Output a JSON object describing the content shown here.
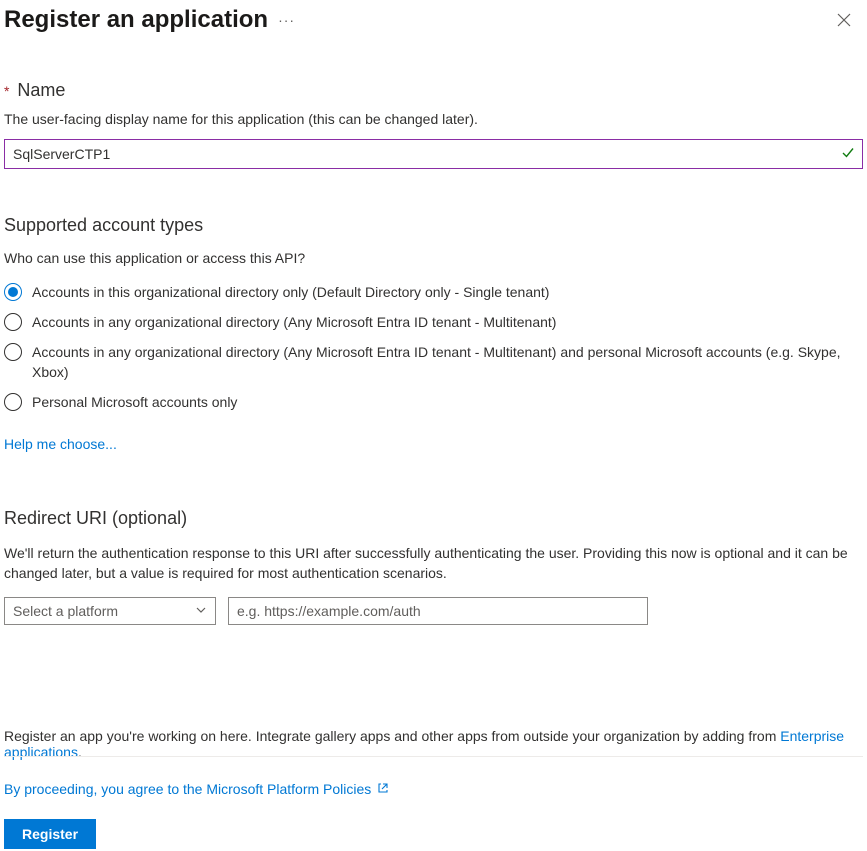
{
  "header": {
    "title": "Register an application"
  },
  "name": {
    "label": "Name",
    "description": "The user-facing display name for this application (this can be changed later).",
    "value": "SqlServerCTP1"
  },
  "accountTypes": {
    "heading": "Supported account types",
    "question": "Who can use this application or access this API?",
    "options": [
      "Accounts in this organizational directory only (Default Directory only - Single tenant)",
      "Accounts in any organizational directory (Any Microsoft Entra ID tenant - Multitenant)",
      "Accounts in any organizational directory (Any Microsoft Entra ID tenant - Multitenant) and personal Microsoft accounts (e.g. Skype, Xbox)",
      "Personal Microsoft accounts only"
    ],
    "selectedIndex": 0,
    "helpLink": "Help me choose..."
  },
  "redirect": {
    "heading": "Redirect URI (optional)",
    "description": "We'll return the authentication response to this URI after successfully authenticating the user. Providing this now is optional and it can be changed later, but a value is required for most authentication scenarios.",
    "platformPlaceholder": "Select a platform",
    "uriPlaceholder": "e.g. https://example.com/auth"
  },
  "footer": {
    "noteBefore": "Register an app you're working on here. Integrate gallery apps and other apps from outside your organization by adding from ",
    "noteLink": "Enterprise applications",
    "noteAfter": ".",
    "policyText": "By proceeding, you agree to the Microsoft Platform Policies",
    "registerLabel": "Register"
  }
}
